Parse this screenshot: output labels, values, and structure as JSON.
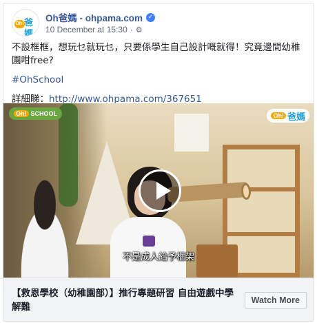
{
  "post": {
    "page_name": "Oh爸媽 - ohpama.com",
    "timestamp": "10 December at 15:30",
    "separator": "·",
    "privacy_icon": "gear-icon",
    "verified_icon": "verified-badge-icon",
    "body_text": "不設框框，想玩乜就玩乜，只要係學生自己設計嘅就得！究竟邊間幼稚園咁free?",
    "hashtag": "#OhSchool",
    "details_label": "詳細睇：",
    "details_link": "http://www.ohpama.com/367651"
  },
  "avatar": {
    "badge_text": "Oh!",
    "brand_text": "爸媽"
  },
  "video": {
    "logo_left_badge": "Oh!",
    "logo_left_text": "SCHOOL",
    "logo_right_badge": "Oh!",
    "logo_right_text": "爸媽",
    "caption": "不是成人給予框架",
    "play_icon": "play-icon"
  },
  "link_preview": {
    "title": "【救恩學校（幼稚園部）】推行專題研習 自由遊戲中學解難",
    "watch_button": "Watch More"
  },
  "colors": {
    "link": "#365899",
    "brand_orange": "#f6a800",
    "brand_blue": "#1a9fd9",
    "verified": "#4080ff"
  }
}
